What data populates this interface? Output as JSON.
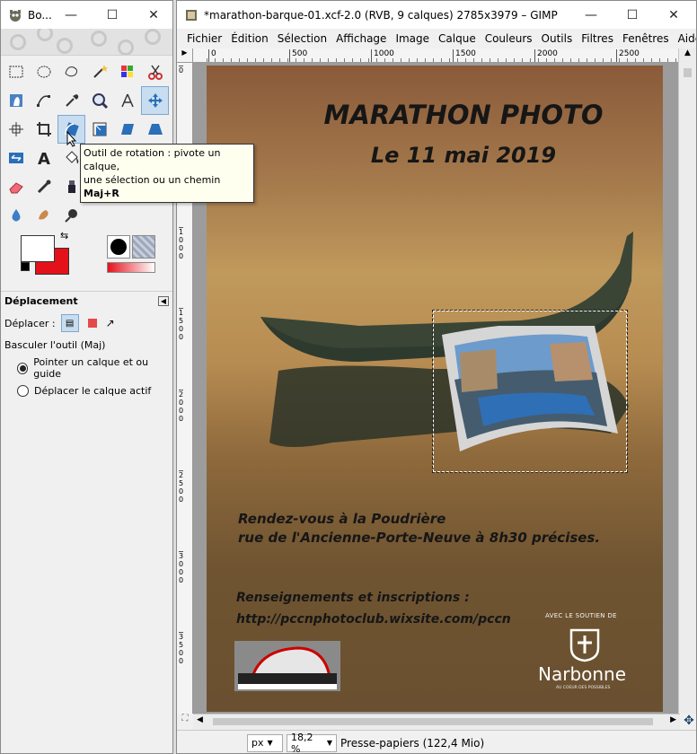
{
  "toolbox": {
    "title": "Bo...",
    "tools": [
      "rect-select-icon",
      "ellipse-select-icon",
      "free-select-icon",
      "fuzzy-select-icon",
      "select-by-color-icon",
      "scissors-icon",
      "foreground-select-icon",
      "paths-icon",
      "color-picker-icon",
      "zoom-icon",
      "measure-icon",
      "move-icon",
      "align-icon",
      "crop-icon",
      "rotate-icon",
      "scale-icon",
      "shear-icon",
      "perspective-icon",
      "flip-icon",
      "text-icon",
      "bucket-fill-icon",
      "",
      "",
      "",
      "eraser-icon",
      "airbrush-icon",
      "ink-icon",
      "clone-icon",
      "heal-icon",
      "perspective-clone-icon",
      "blur-icon",
      "smudge-icon",
      "dodge-burn-icon",
      "",
      "",
      ""
    ],
    "tooltip": {
      "line1": "Outil de rotation : pivote un calque,",
      "line2": "une sélection ou un chemin",
      "shortcut": "Maj+R"
    },
    "options": {
      "title": "Déplacement",
      "move_label": "Déplacer :",
      "toggle_label": "Basculer l'outil  (Maj)",
      "radio1": "Pointer un calque et ou guide",
      "radio2": "Déplacer le calque actif"
    }
  },
  "gimp": {
    "title": "*marathon-barque-01.xcf-2.0 (RVB, 9 calques) 2785x3979 – GIMP",
    "menu": [
      "Fichier",
      "Édition",
      "Sélection",
      "Affichage",
      "Image",
      "Calque",
      "Couleurs",
      "Outils",
      "Filtres",
      "Fenêtres",
      "Aide"
    ],
    "ruler_h": [
      "0",
      "500",
      "1000",
      "1500",
      "2000",
      "2500"
    ],
    "ruler_v": [
      "0",
      "5\n0\n0",
      "1\n0\n0\n0",
      "1\n5\n0\n0",
      "2\n0\n0\n0",
      "2\n5\n0\n0",
      "3\n0\n0\n0",
      "3\n5\n0\n0"
    ],
    "poster": {
      "title": "MARATHON PHOTO",
      "date": "Le 11 mai 2019",
      "rdv1": "Rendez-vous à la Poudrière",
      "rdv2": "rue de l'Ancienne-Porte-Neuve à 8h30 précises.",
      "info1": "Renseignements et inscriptions :",
      "info2": "http://pccnphotoclub.wixsite.com/pccn",
      "sponsor_small": "AVEC LE SOUTIEN DE",
      "sponsor": "Narbonne",
      "sponsor_tag": "AU COEUR DES POSSIBLES"
    },
    "status": {
      "unit": "px",
      "zoom": "18,2 %",
      "info": "Presse-papiers (122,4 Mio)"
    }
  }
}
